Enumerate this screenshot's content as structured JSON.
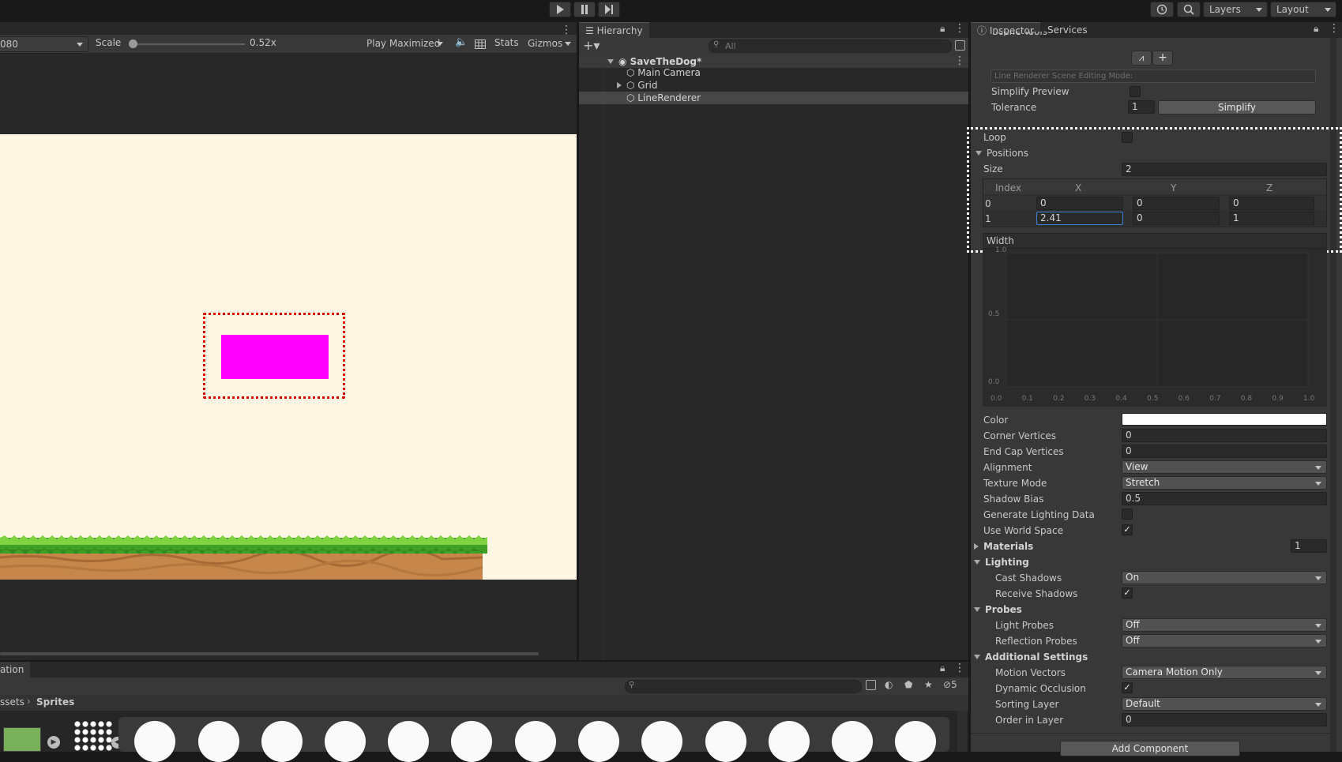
{
  "toolbar": {
    "play_icon": "play-icon",
    "pause_icon": "pause-icon",
    "step_icon": "step-icon",
    "history_icon": "history-icon",
    "search_icon": "search-icon",
    "layers_label": "Layers",
    "layout_label": "Layout"
  },
  "game_view": {
    "resolution": "080",
    "scale_label": "Scale",
    "scale_value": "0.52x",
    "play_mode": "Play Maximized",
    "stats_label": "Stats",
    "gizmos_label": "Gizmos"
  },
  "hierarchy": {
    "tab_label": "Hierarchy",
    "search_placeholder": "All",
    "scene_name": "SaveTheDog*",
    "items": [
      "Main Camera",
      "Grid",
      "LineRenderer"
    ]
  },
  "inspector": {
    "tab_label": "Inspector",
    "services_label": "Services",
    "scene_tools_label": "Scene Tools",
    "editing_mode_label": "Line Renderer Scene Editing Mode:",
    "simplify_preview_label": "Simplify Preview",
    "tolerance_label": "Tolerance",
    "tolerance_value": "1",
    "simplify_button": "Simplify",
    "loop_label": "Loop",
    "positions_label": "Positions",
    "size_label": "Size",
    "size_value": "2",
    "positions_headers": [
      "Index",
      "X",
      "Y",
      "Z"
    ],
    "positions": [
      {
        "index": "0",
        "x": "0",
        "y": "0",
        "z": "0"
      },
      {
        "index": "1",
        "x": "2.41",
        "y": "0",
        "z": "1"
      }
    ],
    "width_label": "Width",
    "width_curve": {
      "y_ticks": [
        "1.0",
        "0.5",
        "0.0"
      ],
      "x_ticks": [
        "0.0",
        "0.1",
        "0.2",
        "0.3",
        "0.4",
        "0.5",
        "0.6",
        "0.7",
        "0.8",
        "0.9",
        "1.0"
      ]
    },
    "color_label": "Color",
    "color_value": "#ffffff",
    "corner_vertices_label": "Corner Vertices",
    "corner_vertices_value": "0",
    "end_cap_vertices_label": "End Cap Vertices",
    "end_cap_vertices_value": "0",
    "alignment_label": "Alignment",
    "alignment_value": "View",
    "texture_mode_label": "Texture Mode",
    "texture_mode_value": "Stretch",
    "shadow_bias_label": "Shadow Bias",
    "shadow_bias_value": "0.5",
    "gen_lighting_label": "Generate Lighting Data",
    "use_world_space_label": "Use World Space",
    "materials_label": "Materials",
    "materials_value": "1",
    "lighting_label": "Lighting",
    "cast_shadows_label": "Cast Shadows",
    "cast_shadows_value": "On",
    "receive_shadows_label": "Receive Shadows",
    "probes_label": "Probes",
    "light_probes_label": "Light Probes",
    "light_probes_value": "Off",
    "reflection_probes_label": "Reflection Probes",
    "reflection_probes_value": "Off",
    "additional_label": "Additional Settings",
    "motion_vectors_label": "Motion Vectors",
    "motion_vectors_value": "Camera Motion Only",
    "dynamic_occlusion_label": "Dynamic Occlusion",
    "sorting_layer_label": "Sorting Layer",
    "sorting_layer_value": "Default",
    "order_in_layer_label": "Order in Layer",
    "order_in_layer_value": "0",
    "add_component_button": "Add Component"
  },
  "project": {
    "tab_label": "ation",
    "breadcrumb_parent": "ssets",
    "breadcrumb_current": "Sprites",
    "hidden_count": "5"
  },
  "colors": {
    "magenta_rect": "#ff00ff",
    "canvas_bg": "#fff7e4"
  }
}
